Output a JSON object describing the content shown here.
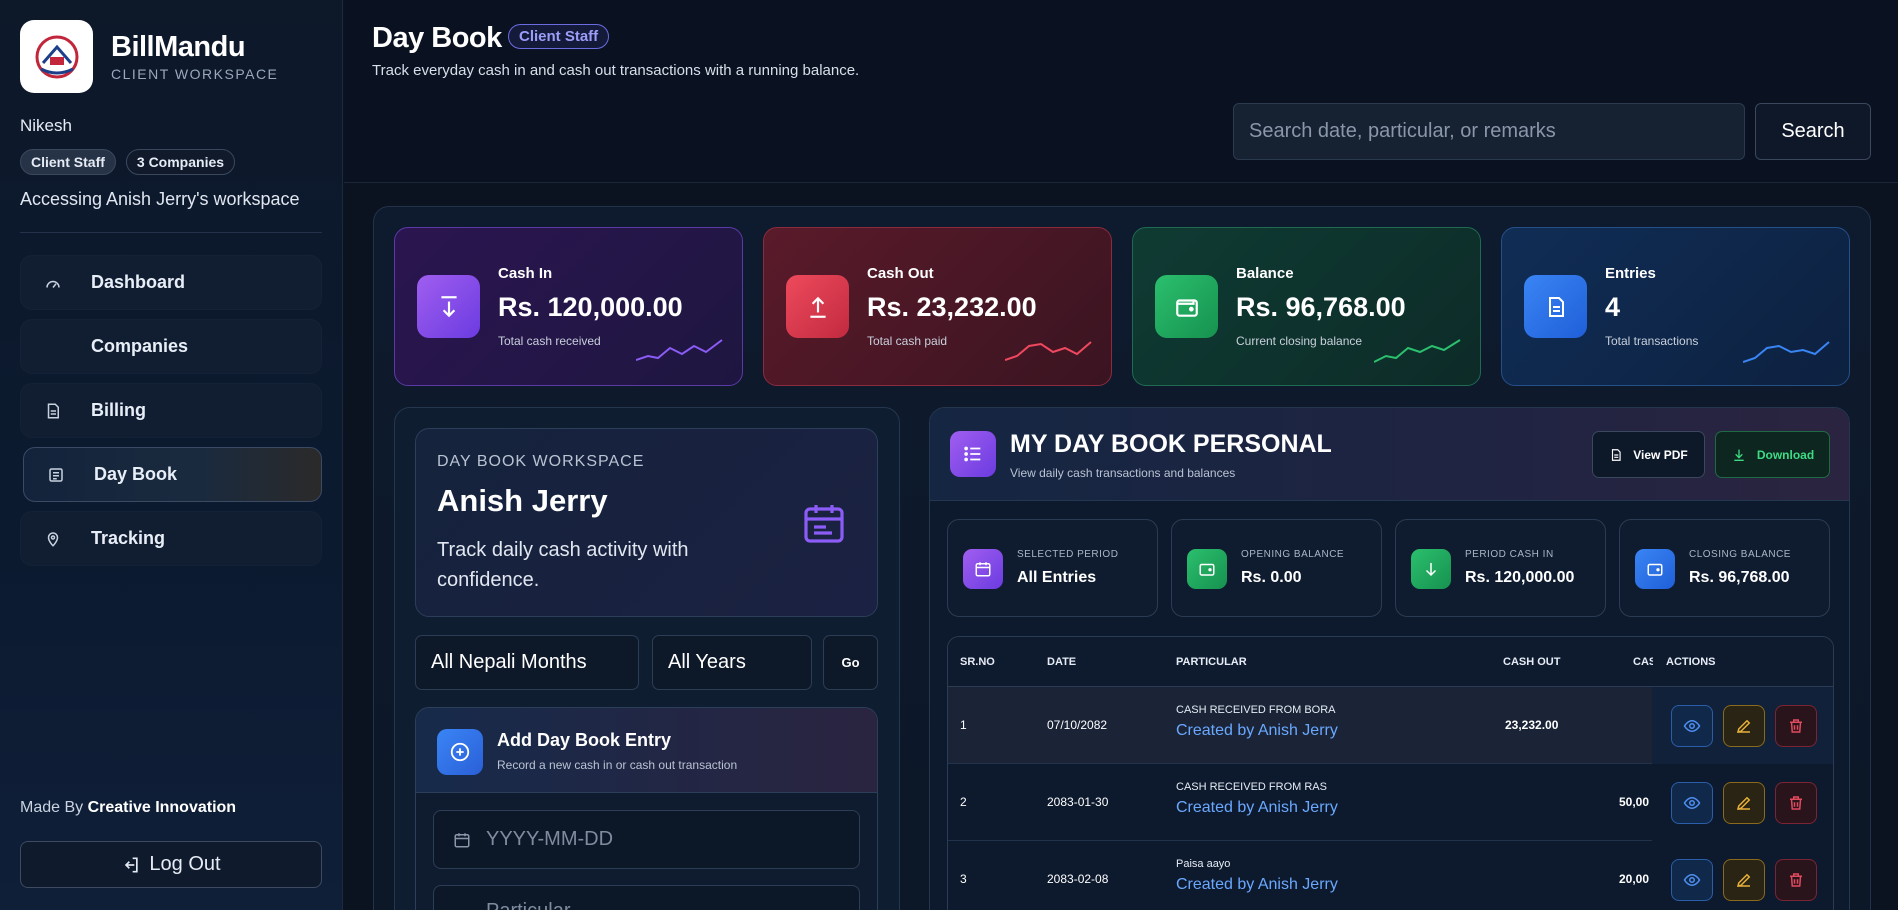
{
  "brand": {
    "name": "BillMandu",
    "subtitle": "CLIENT WORKSPACE"
  },
  "user": {
    "name": "Nikesh",
    "role_badge": "Client Staff",
    "companies_badge": "3 Companies",
    "access_text": "Accessing Anish Jerry's workspace"
  },
  "nav": {
    "items": [
      {
        "label": "Dashboard",
        "icon": "gauge-icon"
      },
      {
        "label": "Companies",
        "icon": ""
      },
      {
        "label": "Billing",
        "icon": "document-icon"
      },
      {
        "label": "Day Book",
        "icon": "ledger-icon",
        "active": true
      },
      {
        "label": "Tracking",
        "icon": "map-pin-icon"
      }
    ]
  },
  "footer": {
    "made_by_prefix": "Made By",
    "made_by_name": "Creative Innovation",
    "logout_label": "Log Out"
  },
  "header": {
    "title": "Day Book",
    "badge": "Client Staff",
    "subtitle": "Track everyday cash in and cash out transactions with a running balance.",
    "search_placeholder": "Search date, particular, or remarks",
    "search_button": "Search"
  },
  "stats": {
    "cash_in": {
      "label": "Cash In",
      "value": "Rs. 120,000.00",
      "sub": "Total cash received",
      "color": "#a05ef0"
    },
    "cash_out": {
      "label": "Cash Out",
      "value": "Rs. 23,232.00",
      "sub": "Total cash paid",
      "color": "#ee4a5c"
    },
    "balance": {
      "label": "Balance",
      "value": "Rs. 96,768.00",
      "sub": "Current closing balance",
      "color": "#2bbf6e"
    },
    "entries": {
      "label": "Entries",
      "value": "4",
      "sub": "Total transactions",
      "color": "#3a85f5"
    }
  },
  "workspace": {
    "kicker": "DAY BOOK WORKSPACE",
    "name": "Anish Jerry",
    "description": "Track daily cash activity with confidence.",
    "month_select": "All Nepali Months",
    "year_select": "All Years",
    "go_label": "Go"
  },
  "add_entry": {
    "title": "Add Day Book Entry",
    "subtitle": "Record a new cash in or cash out transaction",
    "date_placeholder": "YYYY-MM-DD",
    "particular_placeholder": "Particular"
  },
  "daybook": {
    "title": "MY DAY BOOK PERSONAL",
    "subtitle": "View daily cash transactions and balances",
    "view_pdf": "View PDF",
    "download": "Download",
    "summary": [
      {
        "label": "SELECTED PERIOD",
        "value": "All Entries"
      },
      {
        "label": "OPENING BALANCE",
        "value": "Rs. 0.00"
      },
      {
        "label": "PERIOD CASH IN",
        "value": "Rs. 120,000.00"
      },
      {
        "label": "CLOSING BALANCE",
        "value": "Rs. 96,768.00"
      }
    ],
    "columns": [
      "SR.NO",
      "DATE",
      "PARTICULAR",
      "CASH OUT",
      "CAS",
      "ACTIONS"
    ],
    "rows": [
      {
        "sr": "1",
        "date": "07/10/2082",
        "particular": "CASH RECEIVED FROM BORA",
        "creator": "Created by Anish Jerry",
        "cash_out": "23,232.00",
        "cash_in": ""
      },
      {
        "sr": "2",
        "date": "2083-01-30",
        "particular": "CASH RECEIVED FROM RAS",
        "creator": "Created by Anish Jerry",
        "cash_out": "",
        "cash_in": "50,00"
      },
      {
        "sr": "3",
        "date": "2083-02-08",
        "particular": "Paisa aayo",
        "creator": "Created by Anish Jerry",
        "cash_out": "",
        "cash_in": "20,00"
      }
    ]
  }
}
